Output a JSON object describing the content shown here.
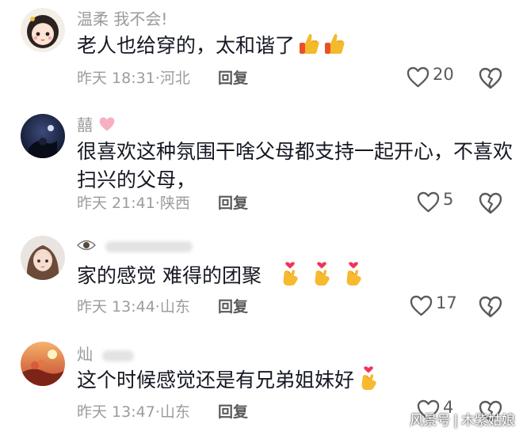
{
  "comments": [
    {
      "username": "温柔 我不会!",
      "text": "老人也给穿的，太和谐了",
      "emoji": [
        "thumbs-up",
        "thumbs-up"
      ],
      "time": "昨天 18:31",
      "location": "河北",
      "reply_label": "回复",
      "likes": "20"
    },
    {
      "username": "囍",
      "text_line1": "很喜欢这种氛围干啥父母都支持一起开心，不喜欢",
      "text_line2": "扫兴的父母，",
      "time": "昨天 21:41",
      "location": "陕西",
      "reply_label": "回复",
      "likes": "5"
    },
    {
      "username": "",
      "text": "家的感觉 难得的团聚",
      "emoji": [
        "finger-heart",
        "finger-heart",
        "finger-heart"
      ],
      "time": "昨天 13:44",
      "location": "山东",
      "reply_label": "回复",
      "likes": "17"
    },
    {
      "username": "灿",
      "text": "这个时候感觉还是有兄弟姐妹好",
      "emoji": [
        "finger-heart"
      ],
      "time": "昨天 13:47",
      "location": "山东",
      "reply_label": "回复",
      "likes": "4"
    }
  ],
  "separator": "·",
  "watermark": {
    "left": "风景号",
    "right": "木紫姑娘"
  },
  "icons": {
    "like": "heart-outline-icon",
    "dislike": "broken-heart-icon"
  },
  "colors": {
    "text": "#161823",
    "meta": "#9c9c9c",
    "icon": "#5a5a5a"
  }
}
